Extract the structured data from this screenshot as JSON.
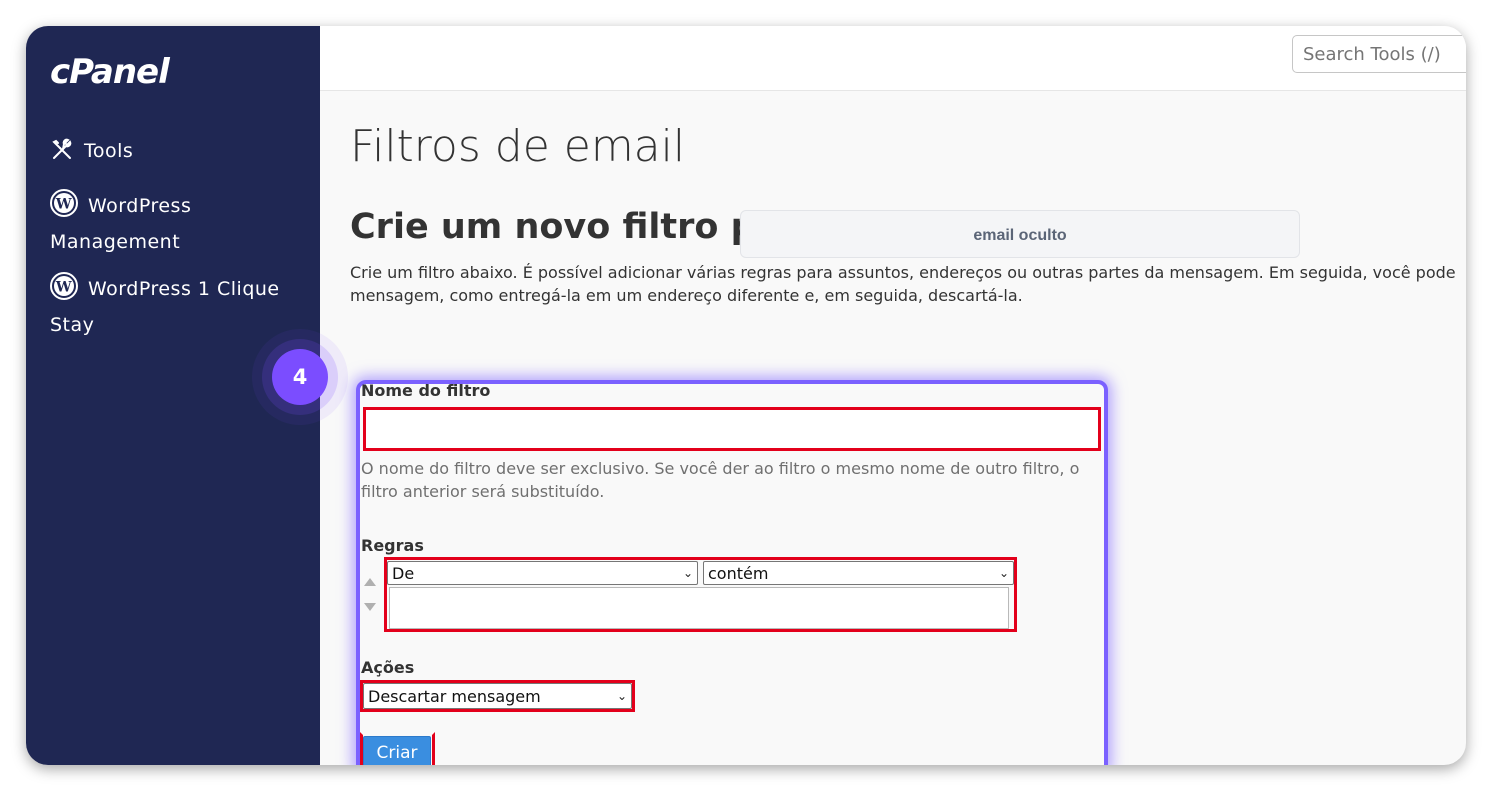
{
  "brand": {
    "logo": "cPanel"
  },
  "sidebar": {
    "items": [
      {
        "label": "Tools",
        "icon": "tools-icon"
      },
      {
        "label": "WordPress Management",
        "icon": "wordpress-icon"
      },
      {
        "label": "WordPress 1 Clique Stay",
        "icon": "wordpress-icon"
      }
    ]
  },
  "header": {
    "search_placeholder": "Search Tools (/)"
  },
  "main": {
    "title": "Filtros de email",
    "subtitle": "Crie um novo filtro par",
    "redaction_label": "email oculto",
    "description": "Crie um filtro abaixo. É possível adicionar várias regras para assuntos, endereços ou outras partes da mensagem. Em seguida, você pode mensagem, como entregá-la em um endereço diferente e, em seguida, descartá-la."
  },
  "form": {
    "filter_name_label": "Nome do filtro",
    "filter_name_value": "",
    "filter_name_help": "O nome do filtro deve ser exclusivo. Se você der ao filtro o mesmo nome de outro filtro, o filtro anterior será substituído.",
    "rules_label": "Regras",
    "rule_field_selected": "De",
    "rule_operator_selected": "contém",
    "rule_value": "",
    "actions_label": "Ações",
    "action_selected": "Descartar mensagem",
    "create_button": "Criar"
  },
  "annotation": {
    "step_number": "4",
    "highlight_color": "#e3001b",
    "accent_color": "#7b61ff"
  },
  "colors": {
    "sidebar_bg": "#1f2753",
    "button_bg": "#3a8ee0"
  }
}
